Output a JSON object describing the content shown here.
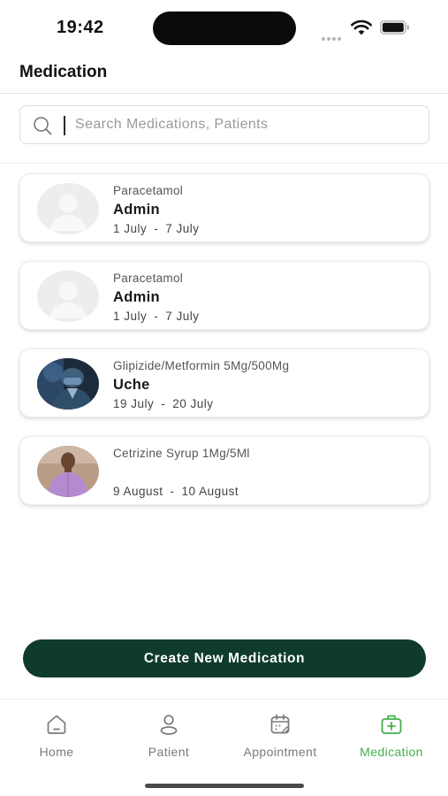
{
  "status_bar": {
    "time": "19:42"
  },
  "header": {
    "title": "Medication"
  },
  "search": {
    "placeholder": "Search Medications, Patients",
    "value": ""
  },
  "medications": [
    {
      "drug": "Paracetamol",
      "patient": "Admin",
      "start": "1 July",
      "separator": "-",
      "end": "7 July",
      "avatar": "placeholder-avatar"
    },
    {
      "drug": "Paracetamol",
      "patient": "Admin",
      "start": "1 July",
      "separator": "-",
      "end": "7 July",
      "avatar": "placeholder-avatar"
    },
    {
      "drug": "Glipizide/Metformin 5Mg/500Mg",
      "patient": "Uche",
      "start": "19 July",
      "separator": "-",
      "end": "20 July",
      "avatar": "doctor-photo"
    },
    {
      "drug": "Cetrizine Syrup 1Mg/5Ml",
      "patient": "",
      "start": "9 August",
      "separator": "-",
      "end": "10 August",
      "avatar": "person-photo"
    }
  ],
  "actions": {
    "create_label": "Create New Medication"
  },
  "bottom_nav": {
    "active": "Medication",
    "items": [
      {
        "label": "Home",
        "icon": "home-icon"
      },
      {
        "label": "Patient",
        "icon": "user-icon"
      },
      {
        "label": "Appointment",
        "icon": "calendar-icon"
      },
      {
        "label": "Medication",
        "icon": "medical-kit-icon"
      }
    ]
  },
  "colors": {
    "primary_button": "#0e3b2c",
    "active_nav": "#43b04a",
    "inactive_nav": "#7a7a7a"
  }
}
